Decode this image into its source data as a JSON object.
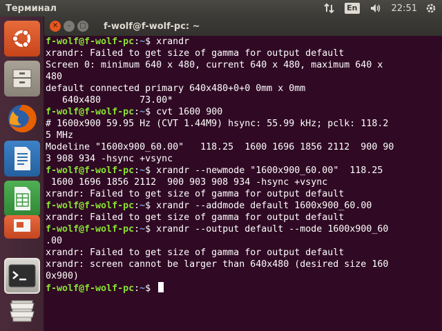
{
  "panel": {
    "app_title": "Терминал",
    "keyboard_layout": "En",
    "clock": "22:51",
    "icons": [
      "network-arrows-icon",
      "keyboard-layout-icon",
      "volume-icon",
      "power-gear-icon"
    ]
  },
  "launcher": {
    "items": [
      {
        "name": "ubuntu-dash-icon",
        "color": "#e95420"
      },
      {
        "name": "files-icon",
        "color": "#9a9285"
      },
      {
        "name": "firefox-icon",
        "color": "#e66000"
      },
      {
        "name": "writer-icon",
        "color": "#2a6fb0"
      },
      {
        "name": "calc-icon",
        "color": "#3e9b43"
      },
      {
        "name": "impress-icon",
        "color": "#d9542b"
      },
      {
        "name": "terminal-icon",
        "color": "#2e2e2e"
      },
      {
        "name": "trash-icon",
        "color": "#8d8a84"
      }
    ]
  },
  "window": {
    "title": "f-wolf@f-wolf-pc: ~"
  },
  "terminal": {
    "lines": [
      {
        "prompt": "f-wolf@f-wolf-pc",
        "path": "~",
        "cmd": " xrandr"
      },
      {
        "text": "xrandr: Failed to get size of gamma for output default"
      },
      {
        "text": "Screen 0: minimum 640 x 480, current 640 x 480, maximum 640 x"
      },
      {
        "text": "480"
      },
      {
        "text": "default connected primary 640x480+0+0 0mm x 0mm"
      },
      {
        "text": "   640x480       73.00*"
      },
      {
        "prompt": "f-wolf@f-wolf-pc",
        "path": "~",
        "cmd": " cvt 1600 900"
      },
      {
        "text": "# 1600x900 59.95 Hz (CVT 1.44M9) hsync: 55.99 kHz; pclk: 118.2"
      },
      {
        "text": "5 MHz"
      },
      {
        "text": "Modeline \"1600x900_60.00\"   118.25  1600 1696 1856 2112  900 90"
      },
      {
        "text": "3 908 934 -hsync +vsync"
      },
      {
        "prompt": "f-wolf@f-wolf-pc",
        "path": "~",
        "cmd": " xrandr --newmode \"1600x900_60.00\"  118.25"
      },
      {
        "text": " 1600 1696 1856 2112  900 903 908 934 -hsync +vsync"
      },
      {
        "text": "xrandr: Failed to get size of gamma for output default"
      },
      {
        "prompt": "f-wolf@f-wolf-pc",
        "path": "~",
        "cmd": " xrandr --addmode default 1600x900_60.00"
      },
      {
        "text": "xrandr: Failed to get size of gamma for output default"
      },
      {
        "prompt": "f-wolf@f-wolf-pc",
        "path": "~",
        "cmd": " xrandr --output default --mode 1600x900_60"
      },
      {
        "text": ".00"
      },
      {
        "text": "xrandr: Failed to get size of gamma for output default"
      },
      {
        "text": "xrandr: screen cannot be larger than 640x480 (desired size 160"
      },
      {
        "text": "0x900)"
      },
      {
        "prompt": "f-wolf@f-wolf-pc",
        "path": "~",
        "cmd": " ",
        "cursor": true
      }
    ]
  },
  "colors": {
    "terminal_bg": "#300a24",
    "prompt_green": "#8ae234",
    "path_blue": "#729fcf",
    "close_orange": "#e6561f"
  }
}
